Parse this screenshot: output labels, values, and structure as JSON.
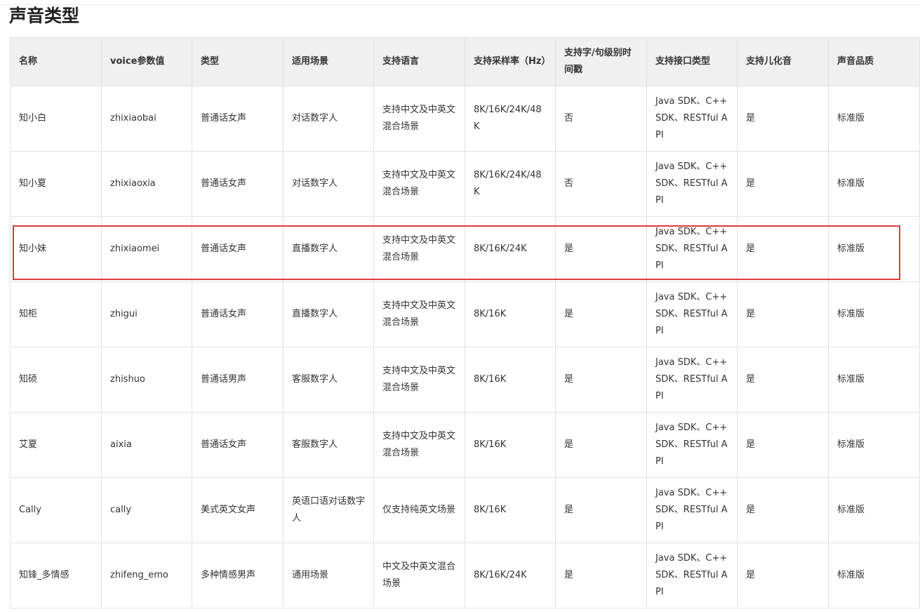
{
  "section_title": "声音类型",
  "table": {
    "headers": [
      "名称",
      "voice参数值",
      "类型",
      "适用场景",
      "支持语言",
      "支持采样率（Hz）",
      "支持字/句级别时间戳",
      "支持接口类型",
      "支持儿化音",
      "声音品质"
    ],
    "rows": [
      [
        "知小白",
        "zhixiaobai",
        "普通话女声",
        "对话数字人",
        "支持中文及中英文混合场景",
        "8K/16K/24K/48K",
        "否",
        "Java SDK、C++ SDK、RESTful API",
        "是",
        "标准版"
      ],
      [
        "知小夏",
        "zhixiaoxia",
        "普通话女声",
        "对话数字人",
        "支持中文及中英文混合场景",
        "8K/16K/24K/48K",
        "否",
        "Java SDK、C++ SDK、RESTful API",
        "是",
        "标准版"
      ],
      [
        "知小妹",
        "zhixiaomei",
        "普通话女声",
        "直播数字人",
        "支持中文及中英文混合场景",
        "8K/16K/24K",
        "是",
        "Java SDK、C++ SDK、RESTful API",
        "是",
        "标准版"
      ],
      [
        "知柜",
        "zhigui",
        "普通话女声",
        "直播数字人",
        "支持中文及中英文混合场景",
        "8K/16K",
        "是",
        "Java SDK、C++ SDK、RESTful API",
        "是",
        "标准版"
      ],
      [
        "知硕",
        "zhishuo",
        "普通话男声",
        "客服数字人",
        "支持中文及中英文混合场景",
        "8K/16K",
        "是",
        "Java SDK、C++ SDK、RESTful API",
        "是",
        "标准版"
      ],
      [
        "艾夏",
        "aixia",
        "普通话女声",
        "客服数字人",
        "支持中文及中英文混合场景",
        "8K/16K",
        "是",
        "Java SDK、C++ SDK、RESTful API",
        "是",
        "标准版"
      ],
      [
        "Cally",
        "cally",
        "美式英文女声",
        "英语口语对话数字人",
        "仅支持纯英文场景",
        "8K/16K",
        "是",
        "Java SDK、C++ SDK、RESTful API",
        "是",
        "标准版"
      ],
      [
        "知锋_多情感",
        "zhifeng_emo",
        "多种情感男声",
        "通用场景",
        "中文及中英文混合场景",
        "8K/16K/24K",
        "是",
        "Java SDK、C++ SDK、RESTful API",
        "是",
        "标准版"
      ]
    ]
  },
  "highlight": {
    "row_index": 2,
    "color": "#e4393c"
  },
  "colors": {
    "header_bg": "#f0f0f0",
    "border": "#e2e2e2",
    "text": "#333333"
  }
}
